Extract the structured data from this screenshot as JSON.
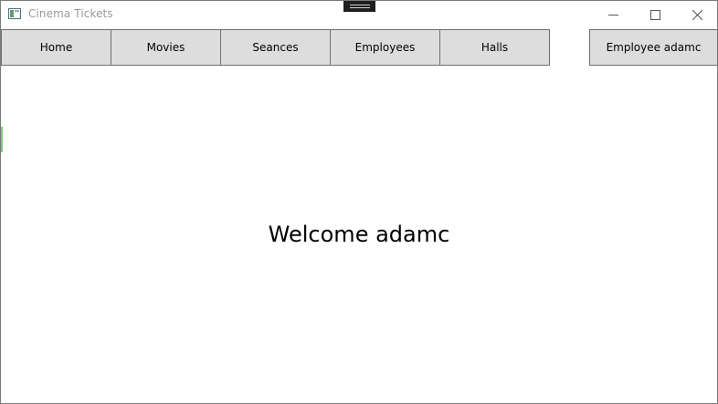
{
  "window": {
    "title": "Cinema Tickets",
    "icon": "app-window-icon"
  },
  "window_controls": {
    "minimize_icon": "minimize-icon",
    "maximize_icon": "maximize-icon",
    "close_icon": "close-icon"
  },
  "nav": {
    "home": "Home",
    "movies": "Movies",
    "seances": "Seances",
    "employees": "Employees",
    "halls": "Halls",
    "user": "Employee adamc"
  },
  "main": {
    "welcome": "Welcome adamc"
  },
  "colors": {
    "button_bg": "#dddddd",
    "button_border": "#707070",
    "title_text": "#999999"
  }
}
